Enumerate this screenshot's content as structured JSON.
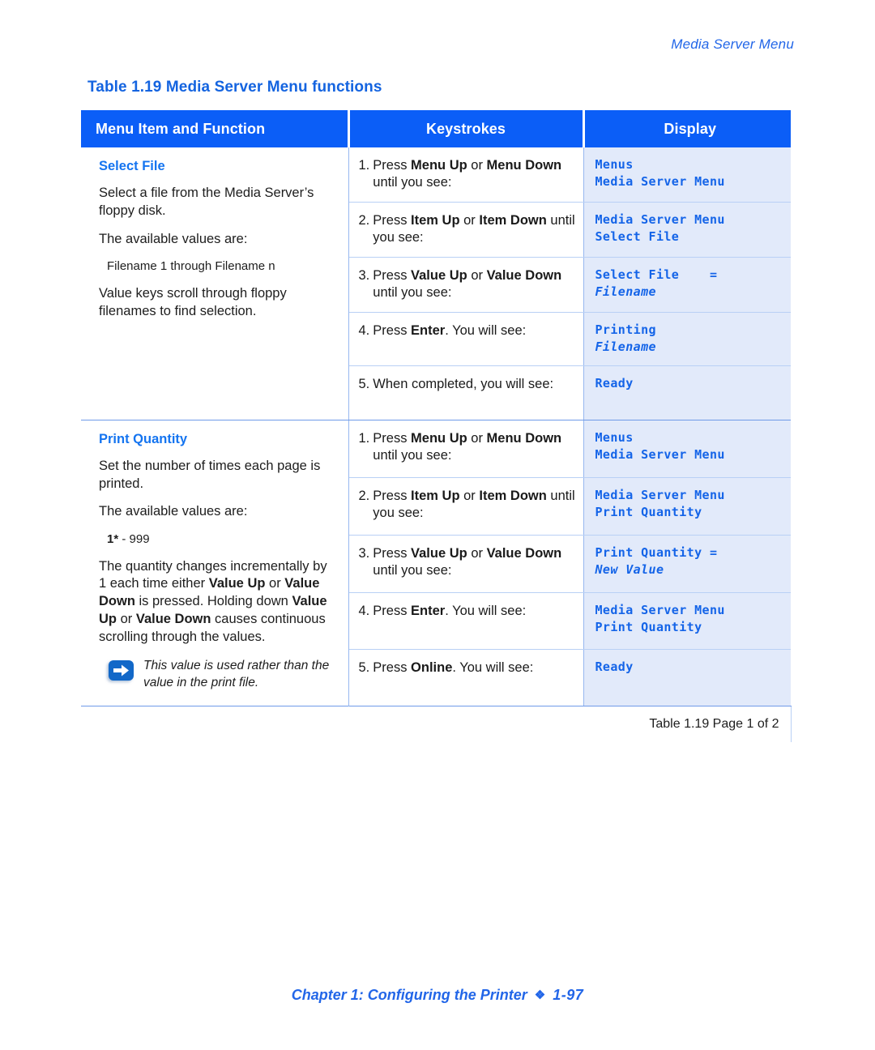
{
  "running_header": "Media Server Menu",
  "table_caption": "Table 1.19  Media Server Menu functions",
  "table": {
    "headers": {
      "menu": "Menu Item and Function",
      "keystrokes": "Keystrokes",
      "display": "Display"
    },
    "sections": [
      {
        "title": "Select File",
        "paragraphs": [
          "Select a file from the Media Server’s floppy disk.",
          "The available values are:"
        ],
        "values_bold": "",
        "values_rest": "Filename 1 through Filename n",
        "paragraph_after": "Value keys scroll through floppy filenames to find selection.",
        "note": null,
        "steps": [
          {
            "num": "1.",
            "parts": [
              {
                "t": "Press ",
                "b": false
              },
              {
                "t": "Menu Up",
                "b": true
              },
              {
                "t": " or ",
                "b": false
              },
              {
                "t": "Menu Down",
                "b": true
              },
              {
                "t": " until you see:",
                "b": false
              }
            ],
            "display_line1": "Menus",
            "display_line2": "Media Server Menu",
            "display_line2_italic": false
          },
          {
            "num": "2.",
            "parts": [
              {
                "t": "Press ",
                "b": false
              },
              {
                "t": "Item Up",
                "b": true
              },
              {
                "t": " or ",
                "b": false
              },
              {
                "t": "Item Down",
                "b": true
              },
              {
                "t": " until you see:",
                "b": false
              }
            ],
            "display_line1": "Media Server Menu",
            "display_line2": "Select File",
            "display_line2_italic": false
          },
          {
            "num": "3.",
            "parts": [
              {
                "t": "Press ",
                "b": false
              },
              {
                "t": "Value Up",
                "b": true
              },
              {
                "t": " or ",
                "b": false
              },
              {
                "t": "Value Down",
                "b": true
              },
              {
                "t": " until you see:",
                "b": false
              }
            ],
            "display_line1": "Select File    =",
            "display_line2": "Filename",
            "display_line2_italic": true
          },
          {
            "num": "4.",
            "parts": [
              {
                "t": "Press ",
                "b": false
              },
              {
                "t": "Enter",
                "b": true
              },
              {
                "t": ". You will see:",
                "b": false
              }
            ],
            "display_line1": "Printing",
            "display_line2": "Filename",
            "display_line2_italic": true
          },
          {
            "num": "5.",
            "parts": [
              {
                "t": "When completed, you will see:",
                "b": false
              }
            ],
            "display_line1": "Ready",
            "display_line2": "",
            "display_line2_italic": false
          }
        ]
      },
      {
        "title": "Print Quantity",
        "paragraphs": [
          "Set the number of times each page is printed.",
          "The available values are:"
        ],
        "values_bold": "1*",
        "values_rest": " - 999",
        "paragraph_after": "",
        "note": "This value is used rather than the value in the print file.",
        "steps": [
          {
            "num": "1.",
            "parts": [
              {
                "t": "Press ",
                "b": false
              },
              {
                "t": "Menu Up",
                "b": true
              },
              {
                "t": " or ",
                "b": false
              },
              {
                "t": "Menu Down",
                "b": true
              },
              {
                "t": " until you see:",
                "b": false
              }
            ],
            "display_line1": "Menus",
            "display_line2": "Media Server Menu",
            "display_line2_italic": false
          },
          {
            "num": "2.",
            "parts": [
              {
                "t": "Press ",
                "b": false
              },
              {
                "t": "Item Up",
                "b": true
              },
              {
                "t": " or ",
                "b": false
              },
              {
                "t": "Item Down",
                "b": true
              },
              {
                "t": " until you see:",
                "b": false
              }
            ],
            "display_line1": "Media Server Menu",
            "display_line2": "Print Quantity",
            "display_line2_italic": false
          },
          {
            "num": "3.",
            "parts": [
              {
                "t": "Press ",
                "b": false
              },
              {
                "t": "Value Up",
                "b": true
              },
              {
                "t": " or ",
                "b": false
              },
              {
                "t": "Value Down",
                "b": true
              },
              {
                "t": " until you see:",
                "b": false
              }
            ],
            "display_line1": "Print Quantity =",
            "display_line2": "New Value",
            "display_line2_italic": true
          },
          {
            "num": "4.",
            "parts": [
              {
                "t": "Press ",
                "b": false
              },
              {
                "t": "Enter",
                "b": true
              },
              {
                "t": ". You will see:",
                "b": false
              }
            ],
            "display_line1": "Media Server Menu",
            "display_line2": "Print Quantity",
            "display_line2_italic": false
          },
          {
            "num": "5.",
            "parts": [
              {
                "t": "Press ",
                "b": false
              },
              {
                "t": "Online",
                "b": true
              },
              {
                "t": ". You will see:",
                "b": false
              }
            ],
            "display_line1": "Ready",
            "display_line2": "",
            "display_line2_italic": false
          }
        ]
      }
    ],
    "footer_note": "Table 1.19  Page 1 of 2"
  },
  "quantity_paragraph_parts": [
    {
      "t": "The quantity changes incrementally by 1 each time either ",
      "b": false
    },
    {
      "t": "Value Up",
      "b": true
    },
    {
      "t": " or ",
      "b": false
    },
    {
      "t": "Value Down",
      "b": true
    },
    {
      "t": " is pressed. Holding down ",
      "b": false
    },
    {
      "t": "Value Up",
      "b": true
    },
    {
      "t": " or ",
      "b": false
    },
    {
      "t": "Value Down",
      "b": true
    },
    {
      "t": " causes continuous scrolling through the values.",
      "b": false
    }
  ],
  "page_footer": {
    "chapter": "Chapter 1: Configuring the Printer",
    "diamond": "❯",
    "page_number": "1-97"
  },
  "colors": {
    "header_blue": "#0b5ef7",
    "accent_blue": "#1474f0",
    "display_bg": "#e2eafa",
    "display_text": "#1464e8",
    "note_icon": "#1268c8"
  }
}
